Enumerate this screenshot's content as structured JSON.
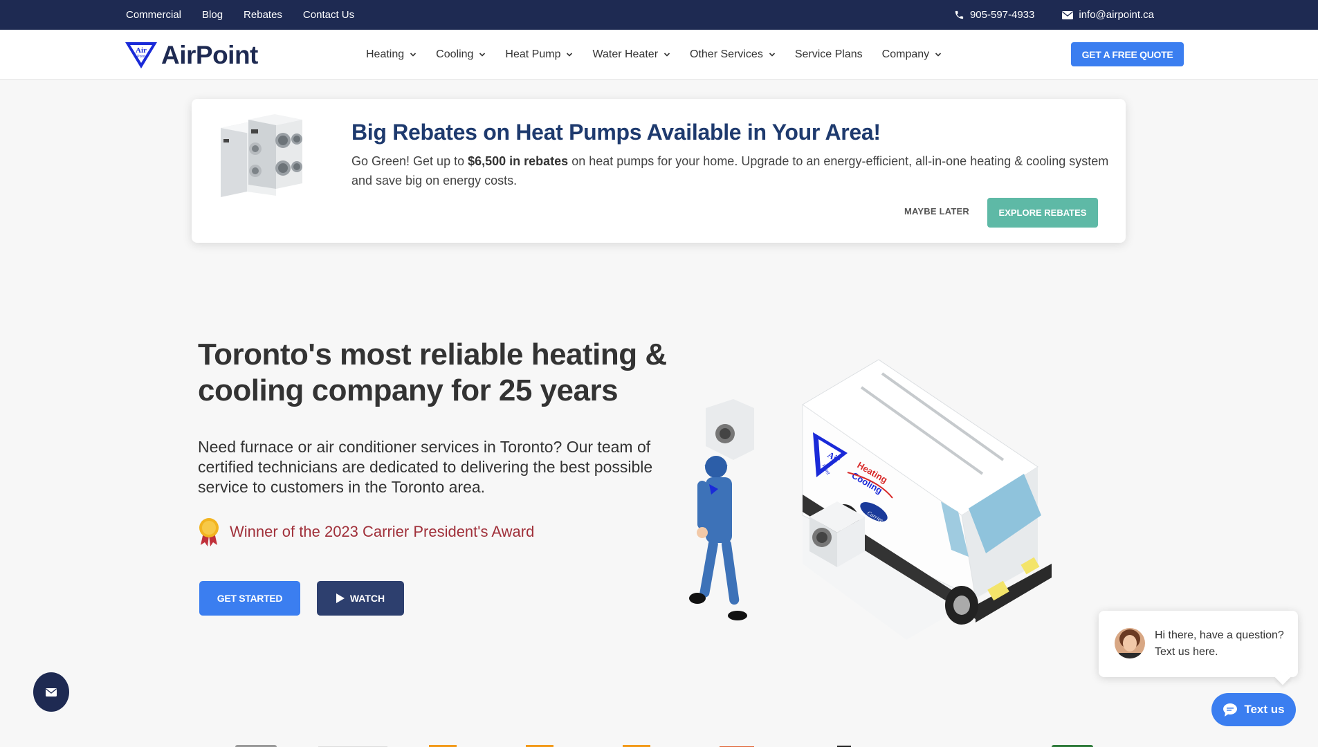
{
  "topbar": {
    "links": [
      "Commercial",
      "Blog",
      "Rebates",
      "Contact Us"
    ],
    "phone": "905-597-4933",
    "email": "info@airpoint.ca"
  },
  "nav": {
    "logo_text": "AirPoint",
    "logo_badge": "Air Point",
    "menu": [
      {
        "label": "Heating",
        "dropdown": true
      },
      {
        "label": "Cooling",
        "dropdown": true
      },
      {
        "label": "Heat Pump",
        "dropdown": true
      },
      {
        "label": "Water Heater",
        "dropdown": true
      },
      {
        "label": "Other Services",
        "dropdown": true
      },
      {
        "label": "Service Plans",
        "dropdown": false
      },
      {
        "label": "Company",
        "dropdown": true
      }
    ],
    "cta": "GET A FREE QUOTE"
  },
  "banner": {
    "title": "Big Rebates on Heat Pumps Available in Your Area!",
    "text_before": "Go Green! Get up to ",
    "text_bold": "$6,500 in rebates",
    "text_after": " on heat pumps for your home. Upgrade to an energy-efficient, all-in-one heating & cooling system and save big on energy costs.",
    "maybe_later": "MAYBE LATER",
    "explore": "EXPLORE REBATES"
  },
  "hero": {
    "title": "Toronto's most reliable heating & cooling company for 25 years",
    "description": "Need furnace or air conditioner services in Toronto? Our team of certified technicians are dedicated to delivering the best possible service to customers in the Toronto area.",
    "award": "Winner of the 2023 Carrier President's Award",
    "get_started": "GET STARTED",
    "watch": "WATCH"
  },
  "van": {
    "brand_air": "Air",
    "brand_point": "Point",
    "heating": "Heating",
    "cooling": "Cooling",
    "carrier": "Carrier"
  },
  "chat": {
    "message": "Hi there, have a question? Text us here.",
    "button": "Text us"
  },
  "colors": {
    "navy": "#1e2a52",
    "primary_blue": "#3b7ef0",
    "teal": "#5eb9a6",
    "award_red": "#a0303a",
    "banner_title": "#1e3a6e"
  }
}
